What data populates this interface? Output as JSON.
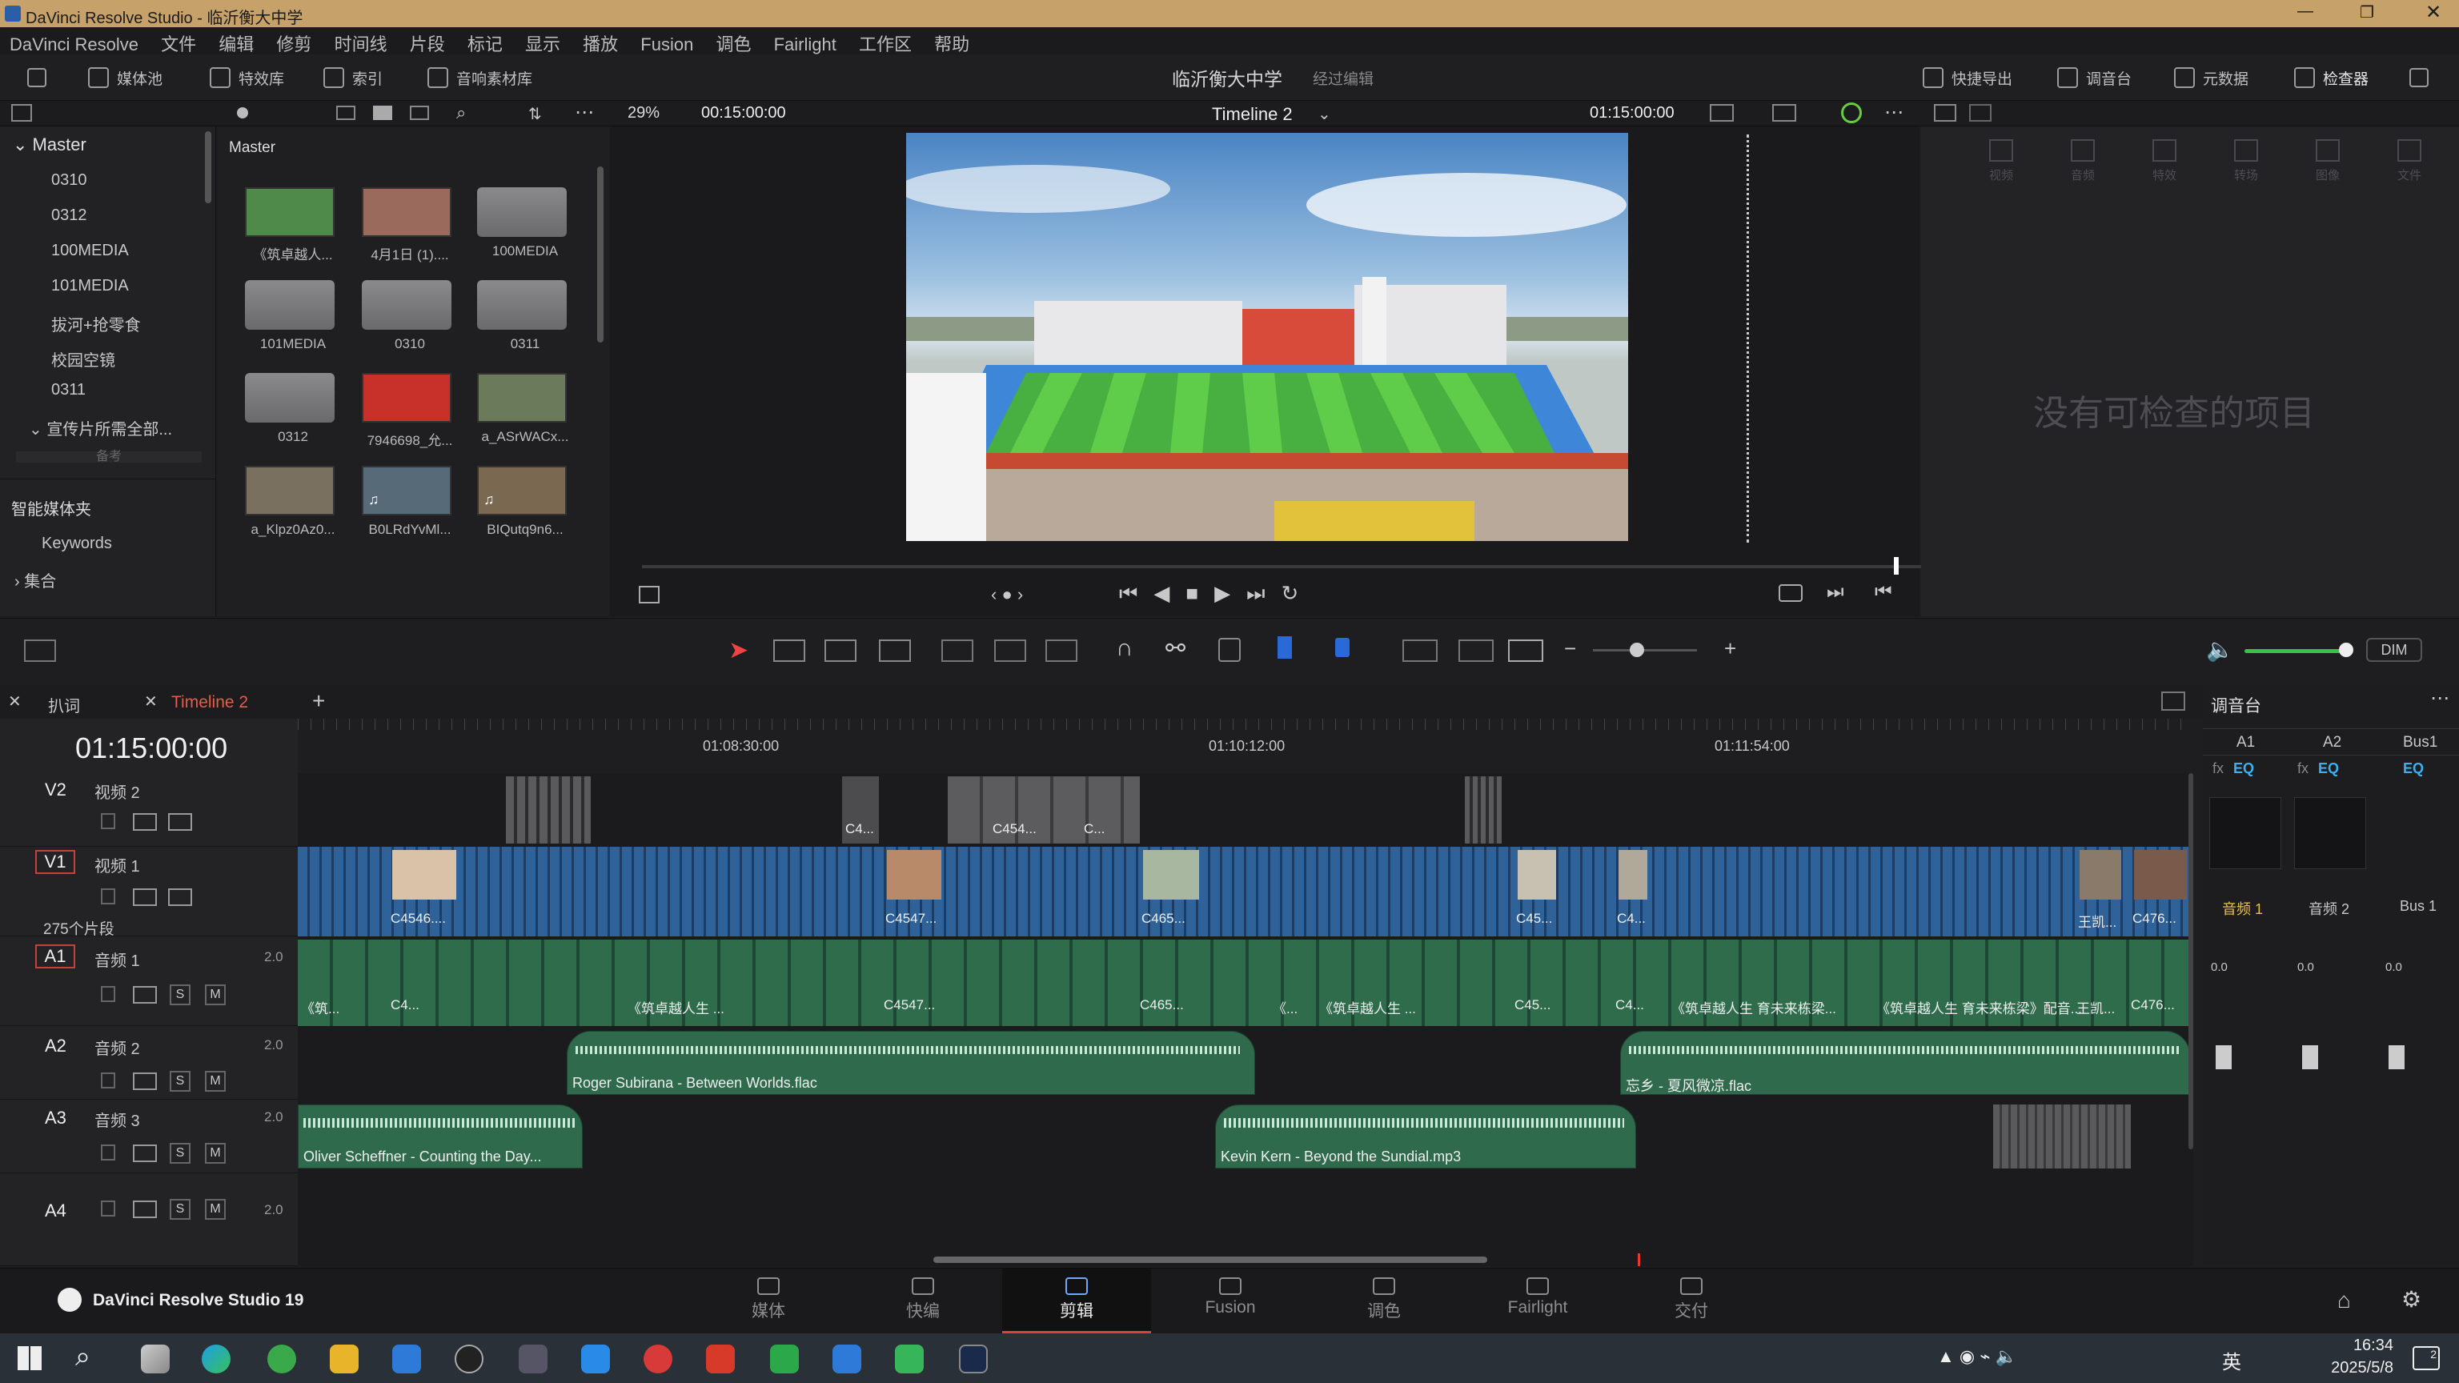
{
  "window": {
    "title": "DaVinci Resolve Studio - 临沂衡大中学"
  },
  "menu": [
    "DaVinci Resolve",
    "文件",
    "编辑",
    "修剪",
    "时间线",
    "片段",
    "标记",
    "显示",
    "播放",
    "Fusion",
    "调色",
    "Fairlight",
    "工作区",
    "帮助"
  ],
  "toolbar": {
    "media_pool": "媒体池",
    "effects": "特效库",
    "index": "索引",
    "sound_library": "音响素材库",
    "project_name": "临沂衡大中学",
    "edited": "经过编辑",
    "quick_export": "快捷导出",
    "mixer": "调音台",
    "metadata": "元数据",
    "inspector": "检查器"
  },
  "viewer": {
    "zoom": "29%",
    "source_tc": "00:15:00:00",
    "timeline_name": "Timeline 2",
    "record_tc": "01:15:00:00"
  },
  "media_pool": {
    "root": "Master",
    "bin_header": "Master",
    "bins": [
      "0310",
      "0312",
      "100MEDIA",
      "101MEDIA",
      "拔河+抢零食",
      "校园空镜",
      "0311",
      "宣传片所需全部..."
    ],
    "collapsed_label": "备考",
    "smart_bins": "智能媒体夹",
    "keywords": "Keywords",
    "collection": "集合",
    "items": [
      {
        "name": "《筑卓越人...",
        "type": "clip",
        "color": "#4f8a4b"
      },
      {
        "name": "4月1日 (1)....",
        "type": "clip",
        "color": "#9a6a5c"
      },
      {
        "name": "100MEDIA",
        "type": "folder"
      },
      {
        "name": "101MEDIA",
        "type": "folder"
      },
      {
        "name": "0310",
        "type": "folder"
      },
      {
        "name": "0311",
        "type": "folder"
      },
      {
        "name": "0312",
        "type": "folder"
      },
      {
        "name": "7946698_允...",
        "type": "image",
        "color": "#c8302a"
      },
      {
        "name": "a_ASrWACx...",
        "type": "image",
        "color": "#6a7a5a"
      },
      {
        "name": "a_Klpz0Az0...",
        "type": "image",
        "color": "#7a7060"
      },
      {
        "name": "B0LRdYvMl...",
        "type": "audio",
        "color": "#566a78"
      },
      {
        "name": "BIQutq9n6...",
        "type": "audio",
        "color": "#7a6850"
      }
    ]
  },
  "inspector": {
    "tabs": [
      "视频",
      "音频",
      "特效",
      "转场",
      "图像",
      "文件"
    ],
    "empty": "没有可检查的项目"
  },
  "transport": {
    "dim": "DIM"
  },
  "timeline": {
    "tabs": [
      "扒词",
      "Timeline 2"
    ],
    "timecode": "01:15:00:00",
    "ruler": [
      "01:08:30:00",
      "01:10:12:00",
      "01:11:54:00"
    ],
    "clip_count": "275个片段",
    "tracks": [
      {
        "id": "V2",
        "name": "视频 2"
      },
      {
        "id": "V1",
        "name": "视频 1"
      },
      {
        "id": "A1",
        "name": "音频 1",
        "level": "2.0"
      },
      {
        "id": "A2",
        "name": "音频 2",
        "level": "2.0"
      },
      {
        "id": "A3",
        "name": "音频 3",
        "level": "2.0"
      },
      {
        "id": "A4",
        "name": "",
        "level": "2.0"
      }
    ],
    "v2_labels": [
      "C4...",
      "C454...",
      "C..."
    ],
    "v1_labels": [
      "C4546....",
      "C4547...",
      "C465...",
      "C45...",
      "C4...",
      "王凯...",
      "C476..."
    ],
    "a1_labels": [
      "《筑...",
      "C4...",
      "《筑卓越人生 ...",
      "C4547...",
      "C465...",
      "《...",
      "《筑卓越人生 ...",
      "C45...",
      "C4...",
      "《筑卓越人生 育未来栋梁...",
      "《筑卓越人生 育未来栋梁》配音...",
      "王凯...",
      "C476..."
    ],
    "a2_clips": [
      "Roger Subirana - Between Worlds.flac",
      "忘乡 - 夏风微凉.flac"
    ],
    "a3_clips": [
      "Oliver Scheffner - Counting the Day...",
      "Kevin Kern - Beyond the Sundial.mp3"
    ],
    "sm": {
      "s": "S",
      "m": "M"
    }
  },
  "mixer": {
    "title": "调音台",
    "channels": [
      "A1",
      "A2",
      "Bus1"
    ],
    "eq": "EQ",
    "fx": "fx",
    "names": [
      "音频 1",
      "音频 2",
      "Bus 1"
    ],
    "level": "0.0",
    "scale": [
      "-5",
      "-10",
      "-15",
      "-20",
      "-30",
      "-40",
      "-50"
    ]
  },
  "pages": {
    "app": "DaVinci Resolve Studio 19",
    "tabs": [
      "媒体",
      "快编",
      "剪辑",
      "Fusion",
      "调色",
      "Fairlight",
      "交付"
    ],
    "active": "剪辑"
  },
  "taskbar": {
    "ime": "英",
    "time": "16:34",
    "date": "2025/5/8",
    "notif": "2"
  }
}
